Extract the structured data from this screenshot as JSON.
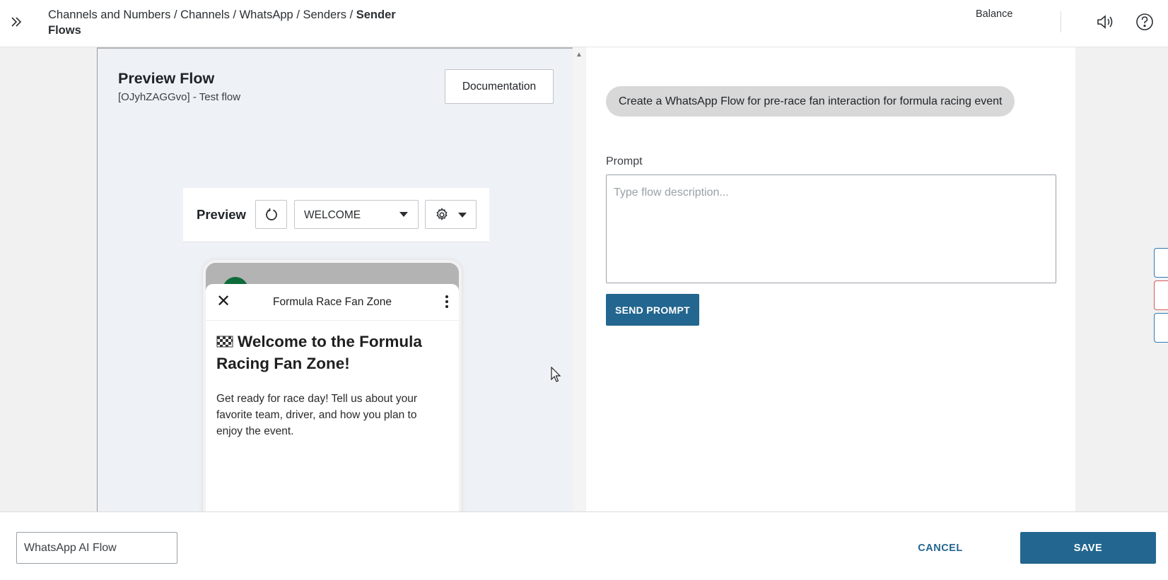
{
  "header": {
    "breadcrumbs": [
      "Channels and Numbers",
      "Channels",
      "WhatsApp",
      "Senders"
    ],
    "current": "Sender Flows",
    "separator": "/",
    "balance_label": "Balance",
    "icons": [
      "double-chevron-right-icon",
      "speaker-icon",
      "help-icon"
    ]
  },
  "preview_flow": {
    "title": "Preview Flow",
    "subtitle": "[OJyhZAGGvo] - Test flow",
    "documentation_label": "Documentation"
  },
  "preview": {
    "label": "Preview",
    "screen_selected": "WELCOME",
    "icons": [
      "refresh-icon",
      "gear-icon",
      "caret-down-icon"
    ]
  },
  "phone": {
    "flow_title": "Formula Race Fan Zone",
    "close_glyph": "✕",
    "heading": "Welcome to the Formula Racing Fan Zone!",
    "body": "Get ready for race day! Tell us about your favorite team, driver, and how you plan to enjoy the event."
  },
  "assistant": {
    "prompt_chip": "Create a WhatsApp Flow for pre-race fan interaction for formula racing event",
    "prompt_label": "Prompt",
    "prompt_placeholder": "Type flow description...",
    "send_label": "SEND PROMPT"
  },
  "footer": {
    "flow_name": "WhatsApp AI Flow",
    "cancel_label": "CANCEL",
    "save_label": "SAVE"
  },
  "colors": {
    "primary": "#23668f",
    "chip_bg": "#d8d8d8",
    "canvas_bg": "#eef1f6",
    "side_tab_border": "#2f7bb5"
  }
}
